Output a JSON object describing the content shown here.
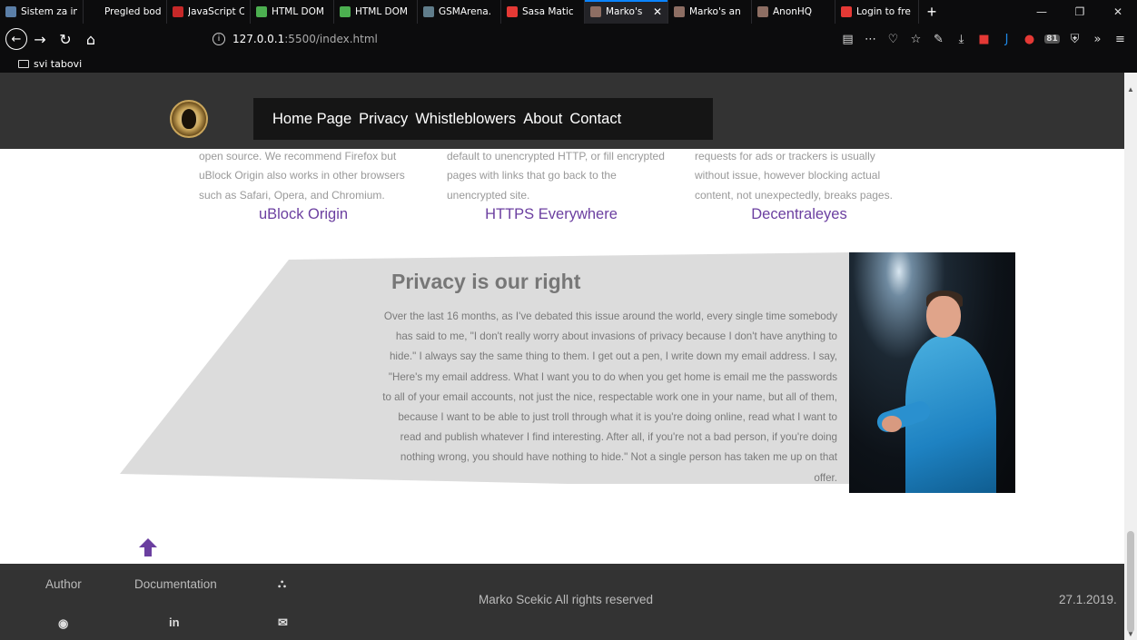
{
  "browser": {
    "tabs": [
      {
        "label": "Sistem za in",
        "color": "#5b7fa8"
      },
      {
        "label": "Pregled bodova",
        "color": "#0c0c0d"
      },
      {
        "label": "JavaScript C",
        "color": "#c62828"
      },
      {
        "label": "HTML DOM",
        "color": "#4caf50"
      },
      {
        "label": "HTML DOM",
        "color": "#4caf50"
      },
      {
        "label": "GSMArena.",
        "color": "#607d8b"
      },
      {
        "label": "Sasa Matic",
        "color": "#e53935"
      },
      {
        "label": "Marko's",
        "color": "#8d6e63"
      },
      {
        "label": "Marko's an",
        "color": "#8d6e63"
      },
      {
        "label": "AnonHQ",
        "color": "#8d6e63"
      },
      {
        "label": "Login to fre",
        "color": "#e53935"
      }
    ],
    "active_tab_index": 7,
    "url_info_icon": "i",
    "url_host": "127.0.0.1",
    "url_path": ":5500/index.html",
    "bookmark_folder": "svi tabovi",
    "toolbar_badge": "81"
  },
  "site": {
    "nav": [
      "Home Page",
      "Privacy",
      "Whistleblowers",
      "About",
      "Contact"
    ],
    "columns": [
      {
        "text": "open source. We recommend Firefox but uBlock Origin also works in other browsers such as Safari, Opera, and Chromium.",
        "title": "uBlock Origin"
      },
      {
        "text": "default to unencrypted HTTP, or fill encrypted pages with links that go back to the unencrypted site.",
        "title": "HTTPS Everywhere"
      },
      {
        "text": "requests for ads or trackers is usually without issue, however blocking actual content, not unexpectedly, breaks pages.",
        "title": "Decentraleyes"
      }
    ],
    "privacy": {
      "title": "Privacy is our right",
      "quote": "Over the last 16 months, as I've debated this issue around the world, every single time somebody has said to me, \"I don't really worry about invasions of privacy because I don't have anything to hide.\" I always say the same thing to them. I get out a pen, I write down my email address. I say, \"Here's my email address. What I want you to do when you get home is email me the passwords to all of your email accounts, not just the nice, respectable work one in your name, but all of them, because I want to be able to just troll through what it is you're doing online, read what I want to read and publish whatever I find interesting. After all, if you're not a bad person, if you're doing nothing wrong, you should have nothing to hide.\" Not a single person has taken me up on that offer."
    },
    "footer": {
      "author": "Author",
      "documentation": "Documentation",
      "rights": "Marko Scekic All rights reserved",
      "date": "27.1.2019.",
      "linkedin": "in"
    },
    "accent": "#6b3fa0"
  }
}
